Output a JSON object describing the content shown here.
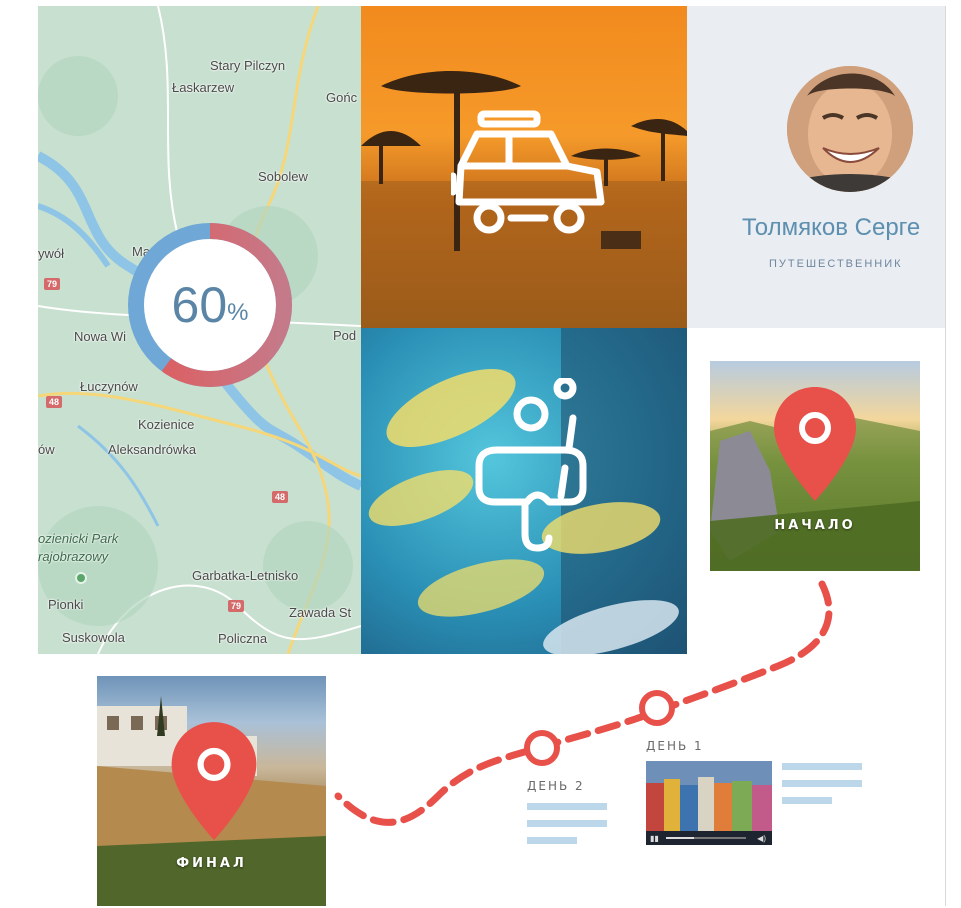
{
  "map": {
    "labels": [
      "Stary Pilczyn",
      "Łaskarzew",
      "Gońc",
      "Sobolew",
      "ywół",
      "Ma",
      "Nowa Wi",
      "Pod",
      "Łuczynów",
      "Kozienice",
      "ów",
      "Aleksandrówka",
      "ozienicki Park",
      "rajobrazowy",
      "Garbatka-Letnisko",
      "Pionki",
      "Zawada St",
      "Suskowola",
      "Policzna"
    ],
    "road_badges": [
      "79",
      "48",
      "48",
      "79"
    ],
    "progress": {
      "value": "60",
      "unit": "%",
      "fraction": 0.6
    },
    "colors": {
      "progress_start": "#e05a5a",
      "progress_end": "#6fa8d6"
    }
  },
  "tiles": {
    "safari_icon": "car-icon",
    "diving_icon": "diving-mask-icon"
  },
  "profile": {
    "name": "Толмяков Серге",
    "role": "ПУТЕШЕСТВЕННИК",
    "avatar_icon": "avatar-photo"
  },
  "route": {
    "start_label": "НАЧАЛО",
    "final_label": "ФИНАЛ",
    "days": [
      {
        "label": "ДЕНЬ 1"
      },
      {
        "label": "ДЕНЬ 2"
      }
    ],
    "colors": {
      "route": "#e8504a",
      "pin": "#e8504a",
      "text_lines": "#bcd7ea"
    }
  },
  "video": {
    "progress_fraction": 0.35,
    "play_icon": "play-icon",
    "volume_icon": "volume-icon"
  }
}
